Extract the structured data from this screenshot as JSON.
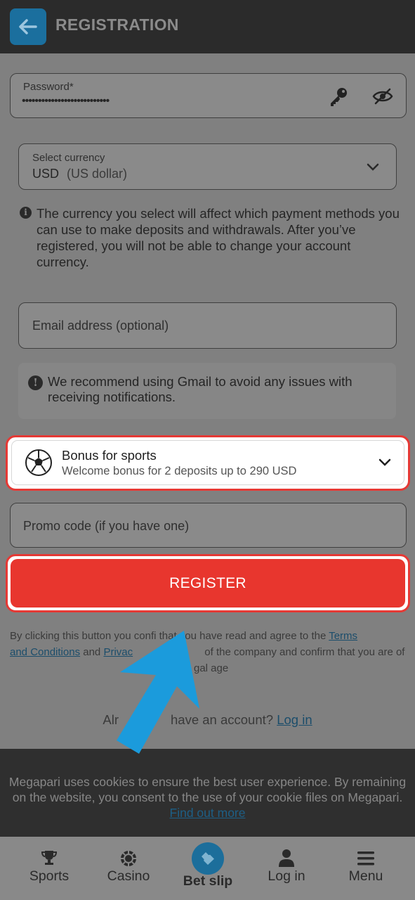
{
  "header": {
    "title": "REGISTRATION",
    "back_icon": "arrow-left-icon"
  },
  "form": {
    "password": {
      "label": "Password*",
      "value": "•••••••••••••••••••••••••••",
      "key_icon": "key-icon",
      "visibility_icon": "eye-slash-icon"
    },
    "currency": {
      "label": "Select currency",
      "code": "USD",
      "name": "(US dollar)",
      "info": "The currency you select will affect which payment methods you can use to make deposits and withdrawals. After you’ve registered, you will not be able to change your account currency."
    },
    "email": {
      "placeholder": "Email address (optional)",
      "note": "We recommend using Gmail to avoid any issues with receiving notifications."
    },
    "bonus": {
      "title": "Bonus for sports",
      "subtitle": "Welcome bonus for 2 deposits up to 290 USD",
      "icon": "soccer-ball-icon"
    },
    "promo": {
      "placeholder": "Promo code (if you have one)"
    },
    "register_label": "REGISTER"
  },
  "terms": {
    "line1_prefix": "By clicking this button you confi",
    "line1_suffix": " that you have read and agree to the ",
    "terms_link_a": "Terms",
    "terms_link_b": "and Conditions",
    "and": " and ",
    "privacy_link": "Privac",
    "line2_suffix": " of the company and confirm that you are of",
    "line3": "gal age"
  },
  "login": {
    "prefix": "Alr",
    "middle": "have an account? ",
    "link": "Log in"
  },
  "cookie": {
    "text": "Megapari uses cookies to ensure the best user experience. By remaining on the website, you consent to the use of your cookie files on Megapari. ",
    "link": "Find out more"
  },
  "bottom_nav": {
    "items": [
      {
        "label": "Sports",
        "icon": "trophy-icon"
      },
      {
        "label": "Casino",
        "icon": "casino-chip-icon"
      },
      {
        "label": "Bet slip",
        "icon": "ticket-icon"
      },
      {
        "label": "Log in",
        "icon": "user-icon"
      },
      {
        "label": "Menu",
        "icon": "menu-icon"
      }
    ]
  },
  "colors": {
    "accent_red": "#e8362e",
    "accent_blue": "#1b9bdc"
  }
}
